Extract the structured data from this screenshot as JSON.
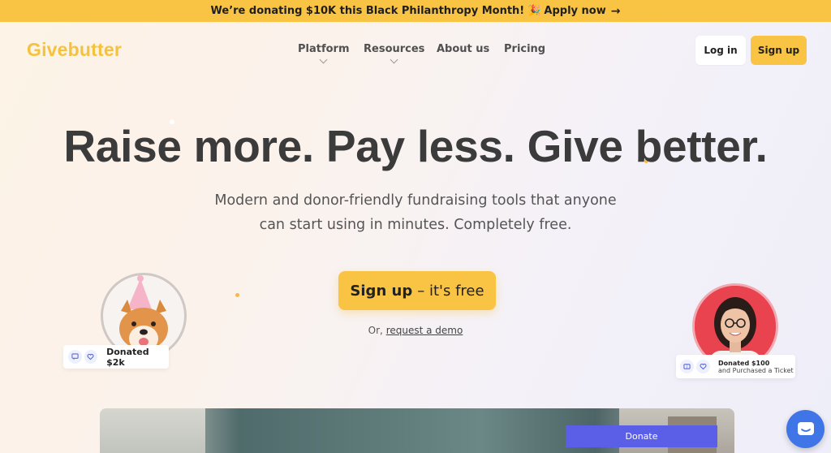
{
  "banner": {
    "text": "We’re donating $10K this Black Philanthropy Month!",
    "emoji": "🎉",
    "link": "Apply now",
    "arrow": "→"
  },
  "header": {
    "logo": "Givebutter",
    "nav": [
      {
        "label": "Platform",
        "has_dropdown": true
      },
      {
        "label": "Resources",
        "has_dropdown": true
      },
      {
        "label": "About us",
        "has_dropdown": false
      },
      {
        "label": "Pricing",
        "has_dropdown": false
      }
    ],
    "login_label": "Log in",
    "signup_label": "Sign up"
  },
  "hero": {
    "headline": "Raise more. Pay less. Give better.",
    "subtitle": "Modern and donor-friendly fundraising tools that anyone can start using in minutes. Completely free.",
    "cta_bold": "Sign up",
    "cta_rest": "– it's free",
    "demo_prefix": "Or,",
    "demo_link": "request a demo"
  },
  "cards": {
    "dog": {
      "text": "Donated $2k"
    },
    "woman": {
      "line1": "Donated $100",
      "line2": "and Purchased a Ticket"
    }
  },
  "video": {
    "donate_label": "Donate"
  },
  "colors": {
    "accent": "#f9c343",
    "logo": "#f4c23d",
    "donate": "#5b5fe8",
    "chat": "#3f75e6"
  }
}
